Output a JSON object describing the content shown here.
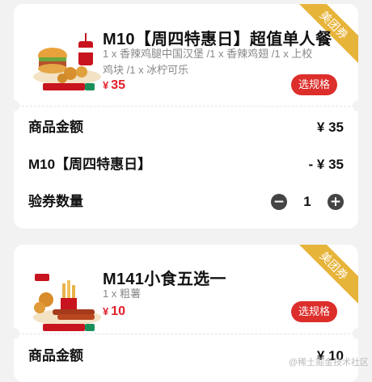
{
  "cards": [
    {
      "badge": "美团券",
      "title": "M10【周四特惠日】超值单人餐",
      "desc": "1 x 香辣鸡腿中国汉堡 /1 x 香辣鸡翅 /1 x 上校鸡块 /1 x 冰柠可乐",
      "currency": "¥",
      "price": "35",
      "spec_label": "选规格",
      "rows": {
        "amount_label": "商品金额",
        "amount_value": "¥ 35",
        "discount_label": "M10【周四特惠日】",
        "discount_value": "- ¥ 35",
        "qty_label": "验券数量",
        "qty_value": "1"
      }
    },
    {
      "badge": "美团券",
      "title": "M141小食五选一",
      "desc": "1 x 粗薯",
      "currency": "¥",
      "price": "10",
      "spec_label": "选规格",
      "rows": {
        "amount_label": "商品金额",
        "amount_value": "¥ 10"
      }
    }
  ],
  "watermark": "@稀土掘金技术社区",
  "colors": {
    "accent_red": "#dc2e2b",
    "price_red": "#e0202a",
    "badge_gold": "#e7b43a",
    "background": "#f2f2f2"
  },
  "icons": {
    "minus": "minus-circle-icon",
    "plus": "plus-circle-icon"
  }
}
